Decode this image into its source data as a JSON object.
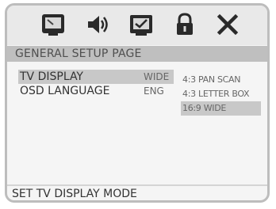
{
  "menu": {
    "page_title": "GENERAL SETUP PAGE",
    "icons": [
      "general-setup-icon",
      "audio-setup-icon",
      "preference-icon",
      "password-lock-icon",
      "exit-icon"
    ]
  },
  "settings": [
    {
      "label": "TV DISPLAY",
      "value": "WIDE"
    },
    {
      "label": "OSD LANGUAGE",
      "value": "ENG"
    }
  ],
  "tv_display_options": [
    "4:3 PAN SCAN",
    "4:3 LETTER BOX",
    "16:9 WIDE"
  ],
  "status_text": "SET TV DISPLAY MODE"
}
